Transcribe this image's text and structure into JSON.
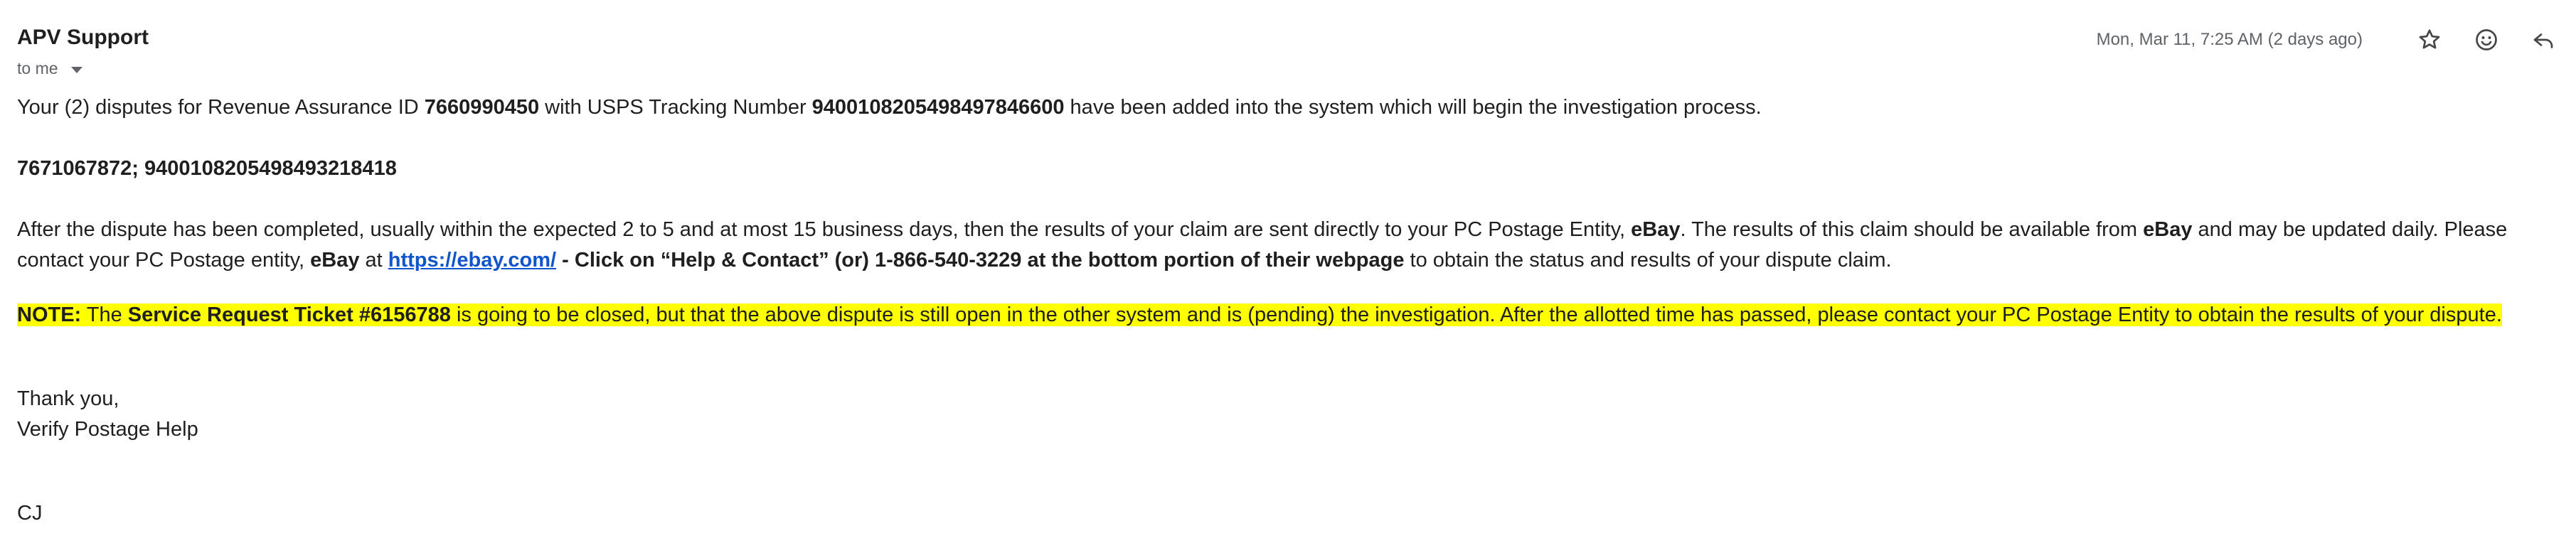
{
  "header": {
    "sender": "APV Support",
    "recipient": "to me",
    "date": "Mon, Mar 11, 7:25 AM (2 days ago)",
    "icons": {
      "star": "star-icon",
      "emoji": "emoji-react-icon",
      "reply": "reply-icon"
    }
  },
  "body": {
    "p1": {
      "t1": "Your (2) disputes for Revenue Assurance ID ",
      "ra_id": "7660990450",
      "t2": " with USPS Tracking Number ",
      "tracking": "9400108205498497846600",
      "t3": " have been added into the system which will begin the investigation process."
    },
    "p2": "7671067872; 9400108205498493218418",
    "p3": {
      "t1": "After the dispute has been completed, usually within the expected 2 to 5 and at most 15 business days, then the results of your claim are sent directly to your PC Postage Entity, ",
      "ebay1": "eBay",
      "t2": ".  The results of this claim should be available from ",
      "ebay2": "eBay",
      "t3": " and may be updated daily.  Please contact your PC Postage entity, ",
      "ebay3": "eBay",
      "t4": " at ",
      "link": "https://ebay.com/",
      "t5": " - Click on “Help & Contact” (or) 1-866-540-3229 at the bottom portion of their webpage",
      "t6": " to obtain the status and results of your dispute claim."
    },
    "note": {
      "label": "NOTE:",
      "t1": "  The ",
      "ticket": "Service Request Ticket #6156788",
      "t2": " is going to be closed, but that the above dispute is still open in the other system and is (pending) the investigation.  After the allotted time has passed, please contact your PC Postage Entity to obtain the results of your dispute."
    },
    "closing": "Thank you,",
    "signature": "Verify Postage Help",
    "initials": "CJ"
  },
  "colors": {
    "link": "#1155cc",
    "highlight": "#ffff00",
    "meta_text": "#5f6368"
  }
}
